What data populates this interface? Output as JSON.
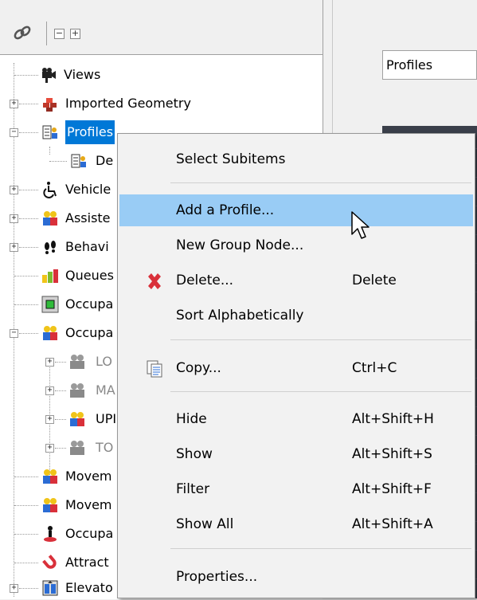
{
  "tree": {
    "nodes": [
      {
        "label": "Views"
      },
      {
        "label": "Imported Geometry"
      },
      {
        "label": "Profiles"
      },
      {
        "label": "De"
      },
      {
        "label": "Vehicle"
      },
      {
        "label": "Assiste"
      },
      {
        "label": "Behavi"
      },
      {
        "label": "Queues"
      },
      {
        "label": "Occupa"
      },
      {
        "label": "Occupa"
      },
      {
        "label": "LO"
      },
      {
        "label": "MA"
      },
      {
        "label": "UPI"
      },
      {
        "label": "TO"
      },
      {
        "label": "Movem"
      },
      {
        "label": "Movem"
      },
      {
        "label": "Occupa"
      },
      {
        "label": "Attract"
      },
      {
        "label": "Elevato"
      }
    ]
  },
  "right_pane": {
    "profiles_dropdown_value": "Profiles"
  },
  "context_menu": {
    "items": [
      {
        "label": "Select Subitems",
        "shortcut": ""
      },
      {
        "label": "Add a Profile...",
        "shortcut": ""
      },
      {
        "label": "New Group Node...",
        "shortcut": ""
      },
      {
        "label": "Delete...",
        "shortcut": "Delete",
        "icon": "delete-x-icon"
      },
      {
        "label": "Sort Alphabetically",
        "shortcut": ""
      },
      {
        "label": "Copy...",
        "shortcut": "Ctrl+C",
        "icon": "copy-icon"
      },
      {
        "label": "Hide",
        "shortcut": "Alt+Shift+H"
      },
      {
        "label": "Show",
        "shortcut": "Alt+Shift+S"
      },
      {
        "label": "Filter",
        "shortcut": "Alt+Shift+F"
      },
      {
        "label": "Show All",
        "shortcut": "Alt+Shift+A"
      },
      {
        "label": "Properties...",
        "shortcut": ""
      }
    ],
    "highlight_color": "#99ccf5"
  },
  "colors": {
    "selection": "#0078d7",
    "menu_highlight": "#99ccf5",
    "delete_red": "#d9303a"
  }
}
